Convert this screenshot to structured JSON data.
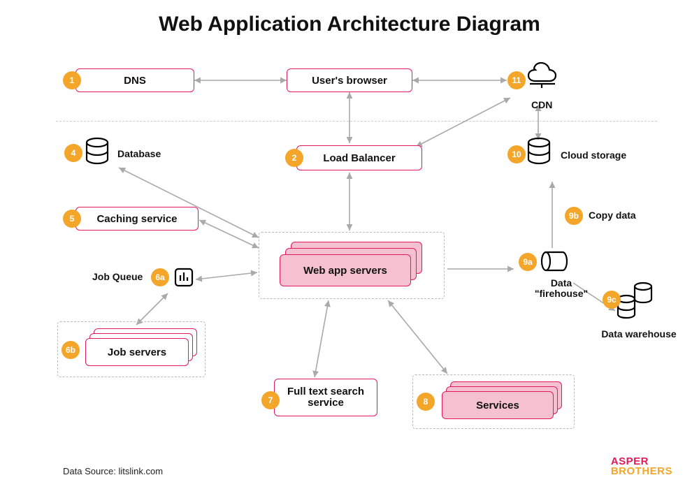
{
  "title": "Web Application Architecture Diagram",
  "dataSource": "Data Source: litslink.com",
  "brand": {
    "line1": "ASPER",
    "line2": "BROTHERS"
  },
  "nodes": {
    "dns": {
      "num": "1",
      "label": "DNS"
    },
    "browser": {
      "label": "User's browser"
    },
    "cdn": {
      "num": "11",
      "label": "CDN"
    },
    "loadBalancer": {
      "num": "2",
      "label": "Load Balancer"
    },
    "database": {
      "num": "4",
      "label": "Database"
    },
    "caching": {
      "num": "5",
      "label": "Caching service"
    },
    "jobQueue": {
      "num": "6a",
      "label": "Job Queue"
    },
    "jobServers": {
      "num": "6b",
      "label": "Job servers"
    },
    "fullText": {
      "num": "7",
      "label": "Full text search service"
    },
    "services": {
      "num": "8",
      "label": "Services"
    },
    "firehouse": {
      "num": "9a",
      "label": "Data \"firehouse\""
    },
    "copyData": {
      "num": "9b",
      "label": "Copy data"
    },
    "dwh": {
      "num": "9c",
      "label": "Data warehouse"
    },
    "cloud": {
      "num": "10",
      "label": "Cloud storage"
    },
    "webServers": {
      "label": "Web app servers"
    }
  }
}
